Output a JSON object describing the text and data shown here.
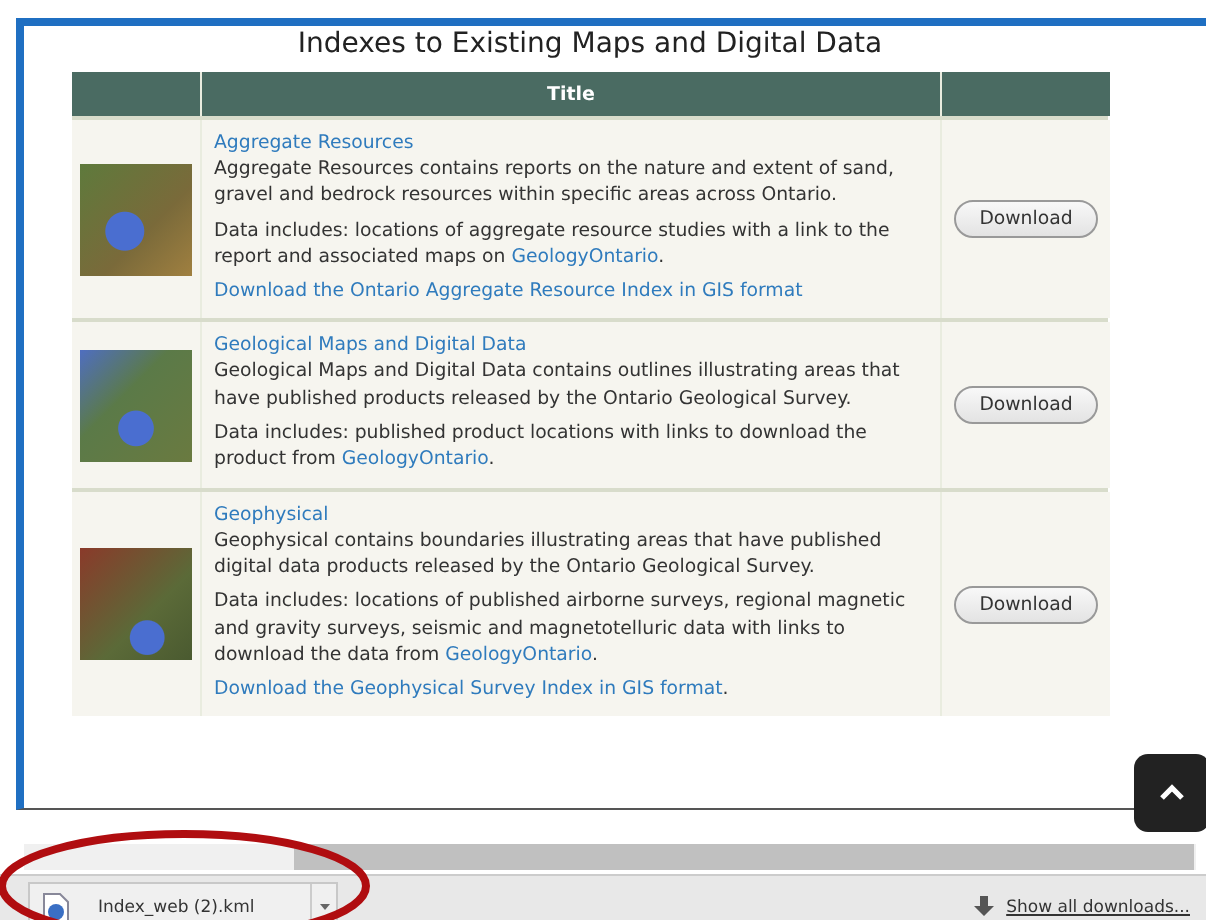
{
  "page": {
    "heading": "Indexes to Existing Maps and Digital Data"
  },
  "table": {
    "columns": [
      "Title"
    ],
    "rows": [
      {
        "title": "Aggregate Resources",
        "description": "Aggregate Resources contains reports on the nature and extent of sand, gravel and bedrock resources within specific areas across Ontario.",
        "details": {
          "text": "Data includes: locations of aggregate resource studies with a link to the report and associated maps on ",
          "link": "GeologyOntario",
          "after": "."
        },
        "gis_link": {
          "text": "Download the Ontario Aggregate Resource Index in GIS format"
        },
        "button": "Download"
      },
      {
        "title": "Geological Maps and Digital Data",
        "description": "Geological Maps and Digital Data contains outlines illustrating areas that have published products released by the Ontario Geological Survey.",
        "details": {
          "text": "Data includes: published product locations with links to download the product from ",
          "link": "GeologyOntario",
          "after": "."
        },
        "button": "Download"
      },
      {
        "title": "Geophysical",
        "description": "Geophysical contains boundaries illustrating areas that have published digital data products released by the Ontario Geological Survey.",
        "details": {
          "text": "Data includes: locations of published airborne surveys, regional magnetic and gravity surveys, seismic and magnetotelluric data with links to download the data from ",
          "link": "GeologyOntario",
          "after": "."
        },
        "gis_link": {
          "text": "Download the Geophysical Survey Index in GIS format",
          "after": "."
        },
        "button": "Download"
      }
    ]
  },
  "download_bar": {
    "file": "Index_web (2).kml",
    "show_all": "Show all downloads..."
  }
}
